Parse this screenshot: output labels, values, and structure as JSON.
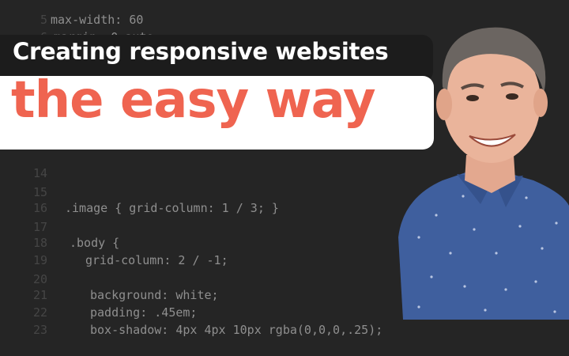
{
  "headline": {
    "line1": "Creating responsive websites",
    "line2": "the easy way"
  },
  "colors": {
    "background": "#252525",
    "accent": "#ef6450",
    "pill": "#ffffff",
    "shirt": "#3f5f9e"
  },
  "code_lines": [
    {
      "ln": "5",
      "text": "max-width: 60",
      "indent": 1
    },
    {
      "ln": "6",
      "text": "margin: 0 auto;",
      "indent": 1
    },
    {
      "ln": "14",
      "text": "",
      "indent": 0
    },
    {
      "ln": "15",
      "text": "",
      "indent": 0
    },
    {
      "ln": "16",
      "text": ".image { grid-column: 1 / 3; }",
      "indent": 0
    },
    {
      "ln": "17",
      "text": "",
      "indent": 0
    },
    {
      "ln": "18",
      "text": ".body {",
      "indent": 0
    },
    {
      "ln": "19",
      "text": "grid-column: 2 / -1;",
      "indent": 1
    },
    {
      "ln": "20",
      "text": "",
      "indent": 0
    },
    {
      "ln": "21",
      "text": "background: white;",
      "indent": 1
    },
    {
      "ln": "22",
      "text": "padding: .45em;",
      "indent": 1
    },
    {
      "ln": "23",
      "text": "box-shadow: 4px 4px 10px rgba(0,0,0,.25);",
      "indent": 1
    }
  ]
}
